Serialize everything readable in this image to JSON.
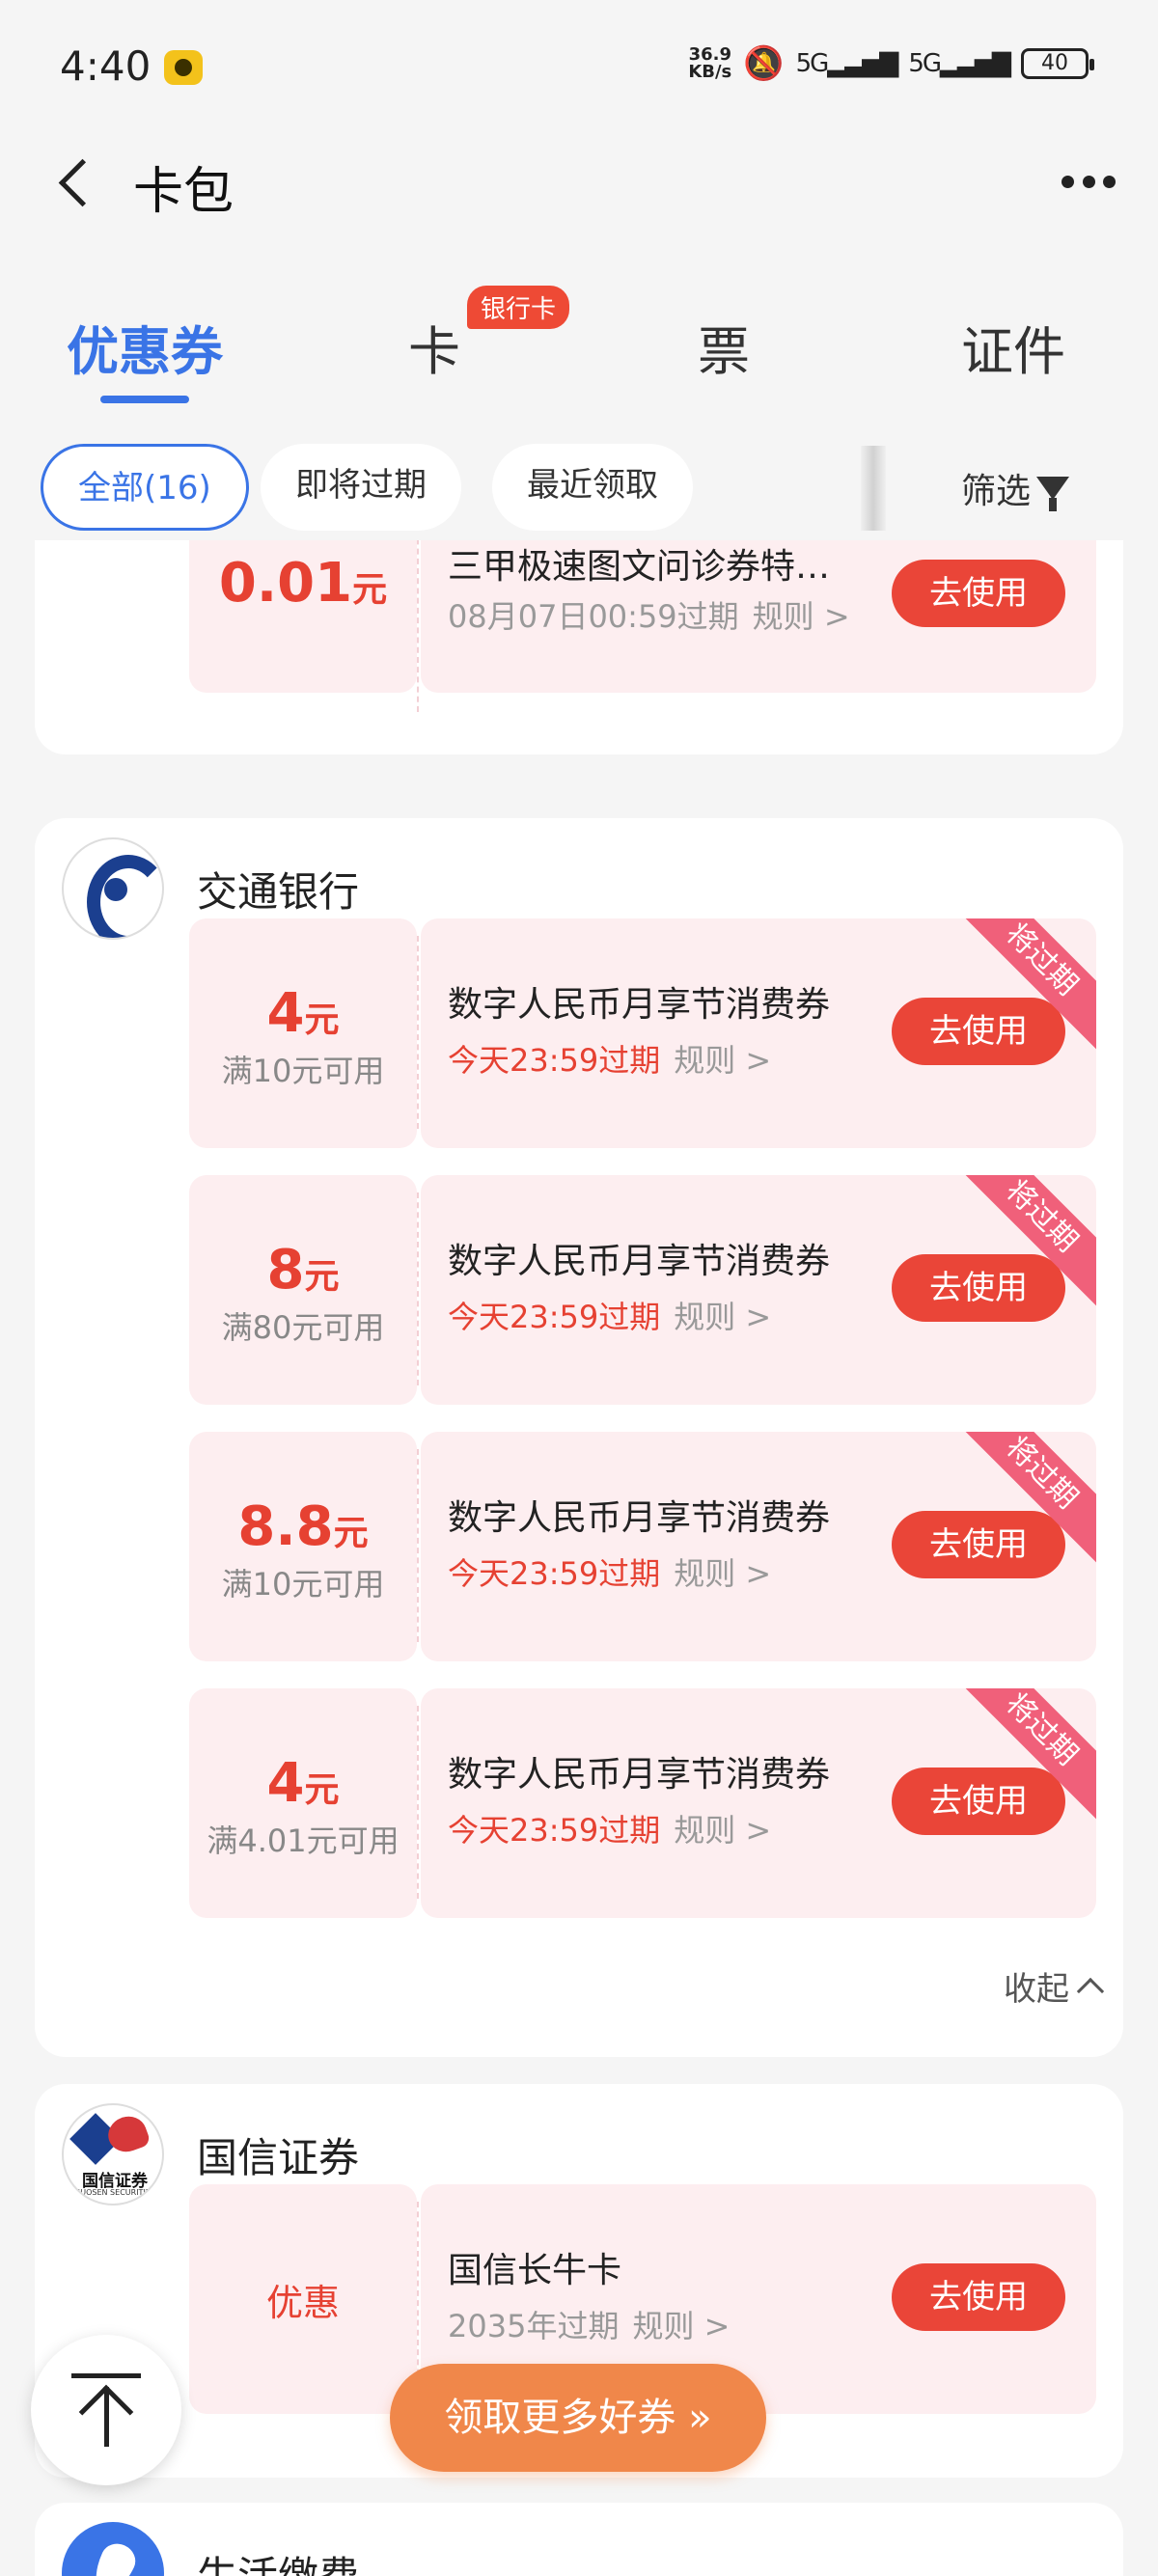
{
  "status_bar": {
    "time": "4:40",
    "net_speed_value": "36.9",
    "net_speed_unit": "KB/s",
    "signal1": "5G",
    "signal2": "5G",
    "battery": "40"
  },
  "nav": {
    "title": "卡包"
  },
  "tabs": [
    {
      "label": "优惠券",
      "active": true
    },
    {
      "label": "卡",
      "badge": "银行卡"
    },
    {
      "label": "票"
    },
    {
      "label": "证件"
    }
  ],
  "filters": {
    "chips": [
      "全部(16)",
      "即将过期",
      "最近领取"
    ],
    "filter_label": "筛选"
  },
  "cards": {
    "partial": {
      "coupon": {
        "amount": "0.01",
        "unit": "元",
        "name": "三甲极速图文问诊券特…",
        "expiry": "08月07日00:59过期",
        "rules": "规则 >",
        "action": "去使用"
      }
    },
    "bocom": {
      "name": "交通银行",
      "collapse": "收起",
      "coupons": [
        {
          "amount": "4",
          "unit": "元",
          "condition": "满10元可用",
          "name": "数字人民币月享节消费券",
          "expiry": "今天23:59过期",
          "rules": "规则 >",
          "action": "去使用",
          "ribbon": "将过期"
        },
        {
          "amount": "8",
          "unit": "元",
          "condition": "满80元可用",
          "name": "数字人民币月享节消费券",
          "expiry": "今天23:59过期",
          "rules": "规则 >",
          "action": "去使用",
          "ribbon": "将过期"
        },
        {
          "amount": "8.8",
          "unit": "元",
          "condition": "满10元可用",
          "name": "数字人民币月享节消费券",
          "expiry": "今天23:59过期",
          "rules": "规则 >",
          "action": "去使用",
          "ribbon": "将过期"
        },
        {
          "amount": "4",
          "unit": "元",
          "condition": "满4.01元可用",
          "name": "数字人民币月享节消费券",
          "expiry": "今天23:59过期",
          "rules": "规则 >",
          "action": "去使用",
          "ribbon": "将过期"
        }
      ]
    },
    "guosen": {
      "name": "国信证券",
      "logo_text": "国信证券",
      "logo_subtext": "GUOSEN SECURITIES",
      "coupon": {
        "amount_text": "优惠",
        "name": "国信长牛卡",
        "expiry": "2035年过期",
        "rules": "规则 >",
        "action": "去使用"
      }
    },
    "life": {
      "name": "生活缴费"
    }
  },
  "floating": {
    "more_coupons": "领取更多好券 »"
  },
  "colors": {
    "accent_blue": "#3a74e6",
    "coupon_red": "#e64132",
    "button_red": "#ea4538",
    "coupon_bg": "#fdeef0",
    "ribbon_pink": "#f0607a",
    "cta_orange": "#f0874a"
  }
}
